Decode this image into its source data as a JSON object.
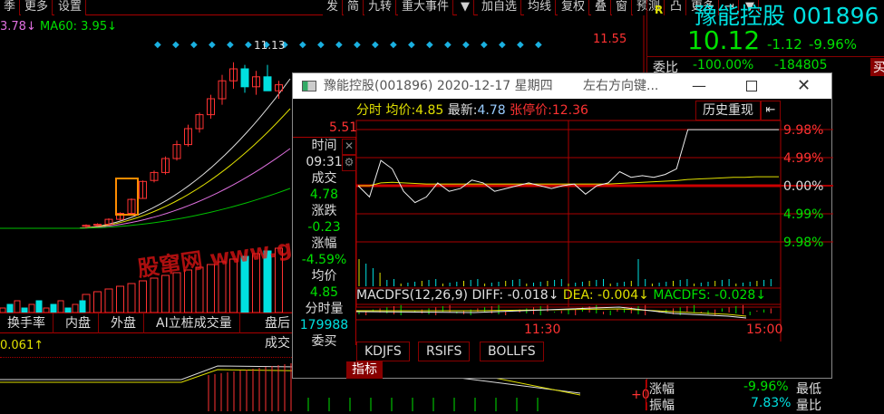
{
  "toolbar": {
    "left": [
      "季",
      "更多",
      "设置"
    ],
    "right": [
      "发",
      "简",
      "九转",
      "重大事件",
      "▼",
      "加自选",
      "均线",
      "复权",
      "叠",
      "窗",
      "预测",
      "凸",
      "更多",
      "⇥",
      "▼"
    ]
  },
  "ma_legend": {
    "ma_prev": "3.78↓",
    "ma60": "MA60: 3.95↓"
  },
  "kline": {
    "price_high_label": "11.55",
    "peak_label": "11.13",
    "candles": [
      [
        2.9,
        3.0,
        2.8,
        2.95
      ],
      [
        2.95,
        3.05,
        2.9,
        3.0
      ],
      [
        3.0,
        3.3,
        2.95,
        3.25
      ],
      [
        3.25,
        3.6,
        3.2,
        3.55
      ],
      [
        3.55,
        4.3,
        3.5,
        4.25
      ],
      [
        4.3,
        5.2,
        4.3,
        5.15
      ],
      [
        5.2,
        5.7,
        5.1,
        5.6
      ],
      [
        5.6,
        6.4,
        5.5,
        6.3
      ],
      [
        6.3,
        7.2,
        6.2,
        7.0
      ],
      [
        7.0,
        8.0,
        6.9,
        7.8
      ],
      [
        7.8,
        8.6,
        7.6,
        8.5
      ],
      [
        8.5,
        9.5,
        8.3,
        9.3
      ],
      [
        9.3,
        10.5,
        9.0,
        10.2
      ],
      [
        10.2,
        11.13,
        9.8,
        10.8
      ],
      [
        10.8,
        11.0,
        9.6,
        9.9
      ],
      [
        9.9,
        10.7,
        9.5,
        10.4
      ],
      [
        10.4,
        11.0,
        9.8,
        9.7
      ],
      [
        9.7,
        10.2,
        9.3,
        10.0
      ]
    ]
  },
  "bottom_tabs": [
    "换手率",
    "内盘",
    "外盘",
    "AI立桩成交量",
    "盘后成交"
  ],
  "indicator_value": "0.061↑",
  "right_panel": {
    "badge": "R",
    "name": "豫能控股 001896",
    "price": "10.12",
    "change": "-1.12",
    "change_pct": "-9.96%",
    "wb_label": "委比",
    "wb_pct": "-100.00%",
    "wb_diff": "-184805",
    "buy_button": "买",
    "plus": "+0",
    "rows": [
      {
        "label": "涨幅",
        "value": "-9.96%",
        "next": "最低"
      },
      {
        "label": "振幅",
        "value": "7.83%",
        "next": "量比"
      }
    ]
  },
  "popup": {
    "title": "豫能控股(001896) 2020-12-17 星期四",
    "hint": "左右方向键...",
    "header": {
      "mode": "分时",
      "avg_label": "均价:",
      "avg": "4.85",
      "last_label": "最新:",
      "last": "4.78",
      "limit_label": "张停价:",
      "limit": "12.36",
      "history_button": "历史重现"
    },
    "left_price": "5.51",
    "info": [
      {
        "label": "时间",
        "value": "09:31"
      },
      {
        "label": "成交",
        "value": "4.78"
      },
      {
        "label": "涨跌",
        "value": "-0.23"
      },
      {
        "label": "涨幅",
        "value": "-4.59%"
      },
      {
        "label": "均价",
        "value": "4.85"
      },
      {
        "label": "分时量",
        "value": "179988"
      },
      {
        "label": "委买",
        "value": ""
      }
    ],
    "pct_axis": [
      "9.98%",
      "4.99%",
      "0.00%",
      "4.99%",
      "9.98%"
    ],
    "macd": {
      "name": "MACDFS(12,26,9)",
      "diff": "DIFF: -0.018↓",
      "dea": "DEA: -0.004↓",
      "macdfs": "MACDFS: -0.028↓"
    },
    "time_axis": [
      "11:30",
      "15:00"
    ],
    "tabs": [
      "KDJFS",
      "RSIFS",
      "BOLLFS"
    ],
    "indicator_tab": "指标",
    "intraday_pct": [
      0,
      -2,
      4.5,
      3,
      -1,
      -3,
      -2,
      0.5,
      -1,
      -0.5,
      1,
      0.5,
      -1,
      -0.5,
      0,
      0.5,
      0,
      -0.5,
      0,
      0.3,
      -1.5,
      0,
      0.5,
      2.5,
      1.5,
      1.8,
      1.5,
      2,
      3,
      9.98,
      9.98,
      9.98,
      9.98,
      9.98,
      9.98,
      9.98,
      9.98,
      9.98
    ],
    "avg_pct": [
      0,
      0,
      0.5,
      0.6,
      0.5,
      0.4,
      0.3,
      0.3,
      0.3,
      0.3,
      0.3,
      0.3,
      0.3,
      0.3,
      0.3,
      0.3,
      0.3,
      0.3,
      0.3,
      0.3,
      0.3,
      0.3,
      0.3,
      0.4,
      0.5,
      0.6,
      0.7,
      0.8,
      0.9,
      1.1,
      1.2,
      1.3,
      1.4,
      1.5,
      1.5,
      1.6,
      1.6,
      1.6
    ]
  },
  "watermark": "股窜网 www.gucuan.com",
  "colors": {
    "up": "#ff3232",
    "down": "#00e000",
    "grid": "#aa0000",
    "cyan": "#00e0e0"
  }
}
